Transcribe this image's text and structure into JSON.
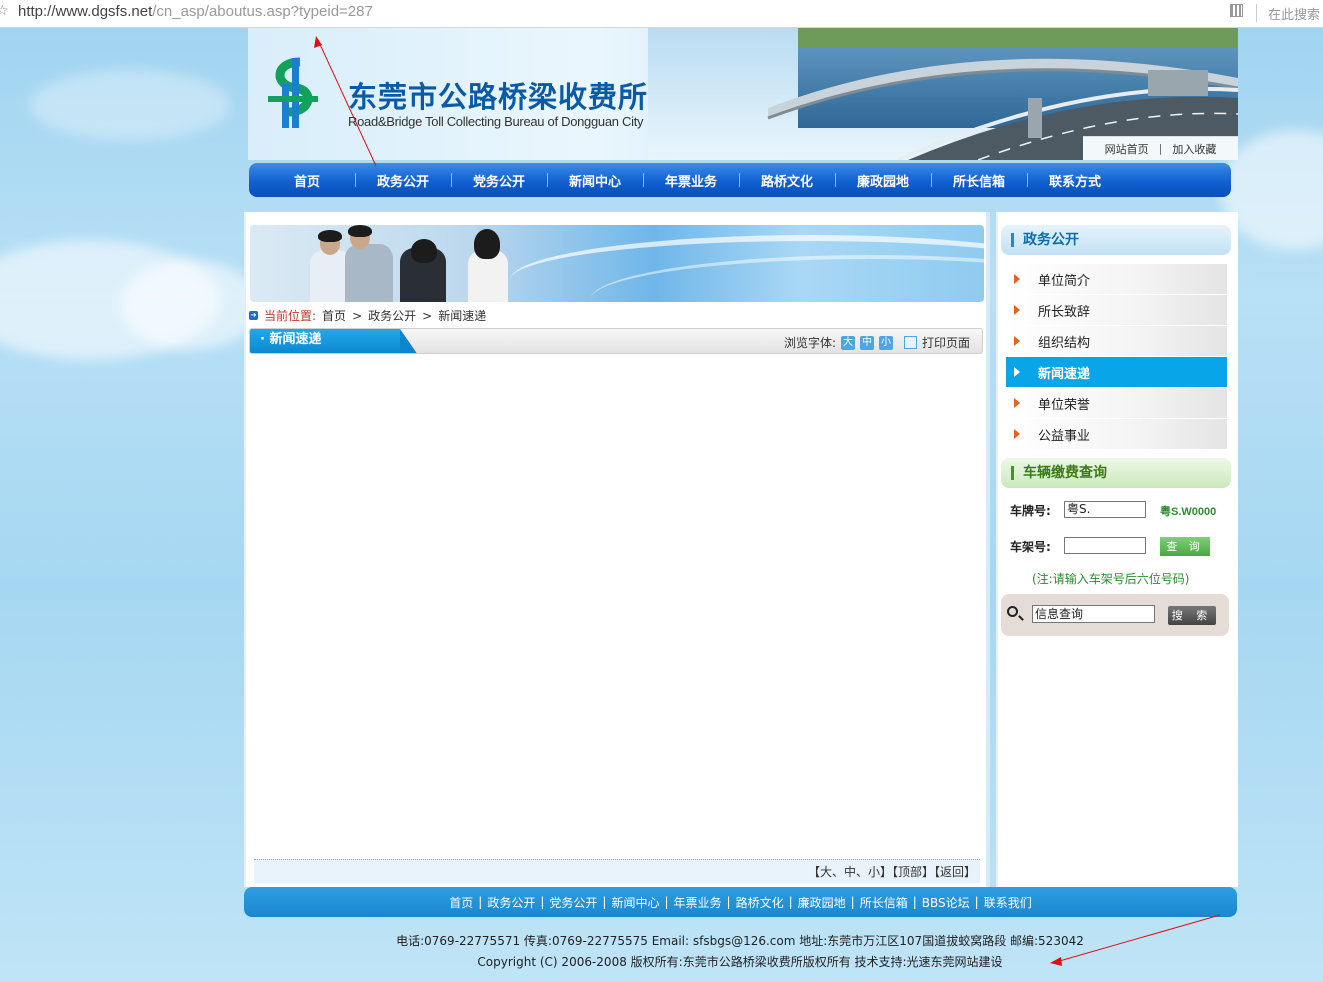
{
  "browser": {
    "url_host": "http://www.dgsfs.net",
    "url_path": "/cn_asp/aboutus.asp?typeid=287",
    "search_placeholder": "在此搜索"
  },
  "header": {
    "title": "东莞市公路桥梁收费所",
    "subtitle": "Road&Bridge Toll Collecting Bureau of Dongguan City",
    "home_link": "网站首页",
    "separator": "|",
    "favorite_link": "加入收藏"
  },
  "nav": [
    "首页",
    "政务公开",
    "党务公开",
    "新闻中心",
    "年票业务",
    "路桥文化",
    "廉政园地",
    "所长信箱",
    "联系方式"
  ],
  "breadcrumb": {
    "label": "当前位置:",
    "home": "首页",
    "sep": ">",
    "section": "政务公开",
    "current": "新闻速递"
  },
  "content": {
    "tab_title": "· 新闻速递",
    "font_label": "浏览字体:",
    "font_large": "大",
    "font_medium": "中",
    "font_small": "小",
    "print_label": "打印页面",
    "bottom_links": "【大、中、小】【顶部】【返回】"
  },
  "sidebar": {
    "section_title": "政务公开",
    "items": [
      {
        "label": "单位简介",
        "active": false
      },
      {
        "label": "所长致辞",
        "active": false
      },
      {
        "label": "组织结构",
        "active": false
      },
      {
        "label": "新闻速递",
        "active": true
      },
      {
        "label": "单位荣誉",
        "active": false
      },
      {
        "label": "公益事业",
        "active": false
      }
    ],
    "query_title": "车辆缴费查询",
    "plate_label": "车牌号:",
    "plate_value": "粤S.",
    "plate_hint": "粤S.W0000",
    "frame_label": "车架号:",
    "frame_value": "",
    "query_button": "查 询",
    "note": "(注:请输入车架号后六位号码)",
    "search_value": "信息查询",
    "search_button": "搜 索"
  },
  "footer": {
    "links": [
      "首页",
      "政务公开",
      "党务公开",
      "新闻中心",
      "年票业务",
      "路桥文化",
      "廉政园地",
      "所长信箱",
      "BBS论坛",
      "联系我们"
    ],
    "contact": "电话:0769-22775571 传真:0769-22775575 Email: sfsbgs@126.com 地址:东莞市万江区107国道拔蛟窝路段 邮编:523042",
    "copyright": "Copyright (C) 2006-2008 版权所有:东莞市公路桥梁收费所版权所有  技术支持:光速东莞网站建设"
  },
  "colors": {
    "nav_blue": "#1060d2",
    "active_item": "#08a6e8",
    "accent_green": "#2e8b2e",
    "annotation_red": "#e01010"
  }
}
